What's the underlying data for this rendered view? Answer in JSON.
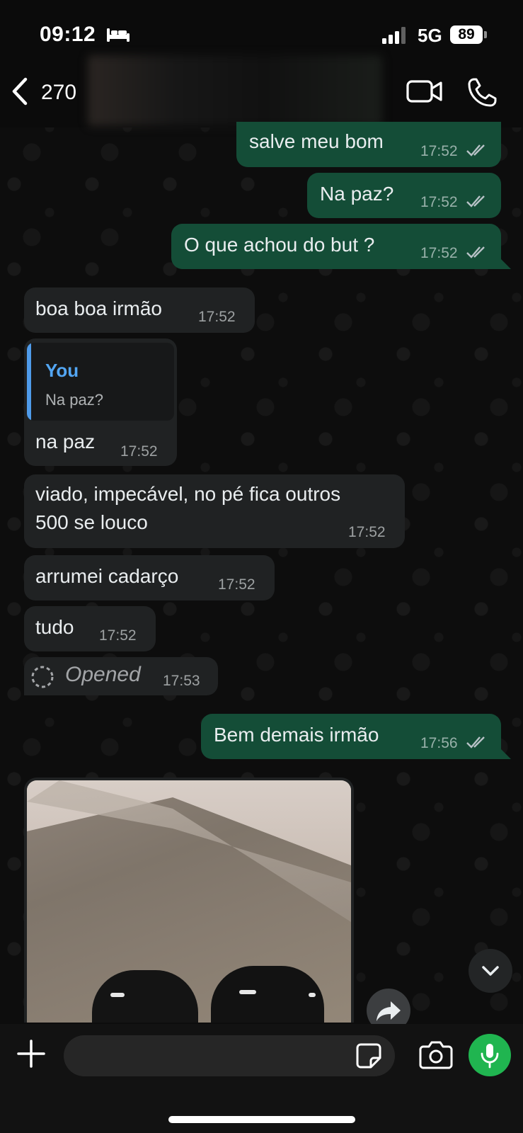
{
  "status_bar": {
    "time": "09:12",
    "network": "5G",
    "battery": "89"
  },
  "header": {
    "back_count": "270"
  },
  "messages": [
    {
      "direction": "out",
      "text": "salve meu bom",
      "time": "17:52"
    },
    {
      "direction": "out",
      "text": "Na paz?",
      "time": "17:52"
    },
    {
      "direction": "out",
      "text": "O que achou do but ?",
      "time": "17:52"
    },
    {
      "direction": "in",
      "text": "boa boa irmão",
      "time": "17:52"
    },
    {
      "direction": "in",
      "quote_author": "You",
      "quote_text": "Na paz?",
      "text": "na paz",
      "time": "17:52"
    },
    {
      "direction": "in",
      "text_line1": "viado, impecável, no pé fica outros",
      "text_line2": "500 se louco",
      "time": "17:52"
    },
    {
      "direction": "in",
      "text": "arrumei cadarço",
      "time": "17:52"
    },
    {
      "direction": "in",
      "text": "tudo",
      "time": "17:52"
    },
    {
      "direction": "in",
      "type": "view-once",
      "text": "Opened",
      "time": "17:53"
    },
    {
      "direction": "out",
      "text": "Bem demais irmão",
      "time": "17:56"
    }
  ],
  "input": {
    "placeholder": ""
  },
  "colors": {
    "outgoing_bubble": "#144d37",
    "incoming_bubble": "#202223",
    "quote_accent": "#53a6f3",
    "mic_button": "#20b550"
  },
  "icons": [
    "bed-icon",
    "signal-icon",
    "back-chevron-icon",
    "video-call-icon",
    "phone-call-icon",
    "read-ticks-icon",
    "view-once-icon",
    "forward-icon",
    "chevron-down-icon",
    "plus-icon",
    "sticker-icon",
    "camera-icon",
    "mic-icon"
  ]
}
